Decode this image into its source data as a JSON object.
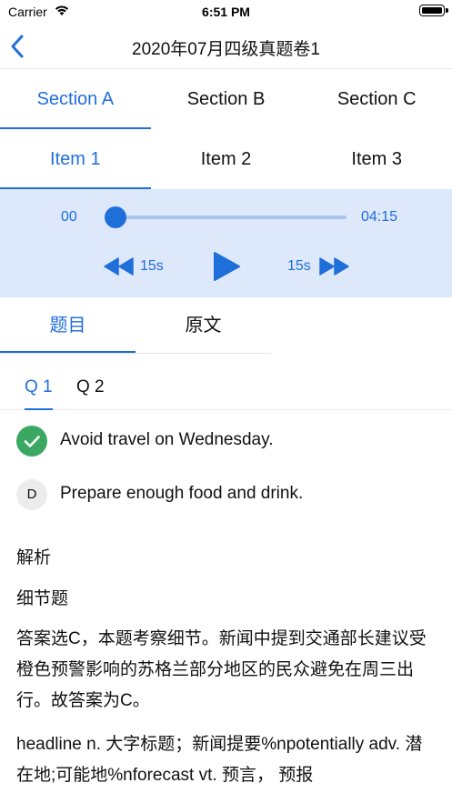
{
  "status": {
    "carrier": "Carrier",
    "time": "6:51 PM"
  },
  "nav": {
    "title": "2020年07月四级真题卷1"
  },
  "section_tabs": [
    {
      "label": "Section A",
      "active": true
    },
    {
      "label": "Section B",
      "active": false
    },
    {
      "label": "Section C",
      "active": false
    }
  ],
  "item_tabs": [
    {
      "label": "Item 1",
      "active": true
    },
    {
      "label": "Item 2",
      "active": false
    },
    {
      "label": "Item 3",
      "active": false
    }
  ],
  "player": {
    "current_time": "00",
    "total_time": "04:15",
    "progress": 0,
    "rewind_label": "15s",
    "forward_label": "15s",
    "accent_color": "#1f6fdb",
    "background_color": "#dde8fb"
  },
  "content_tabs": [
    {
      "label": "题目",
      "active": true
    },
    {
      "label": "原文",
      "active": false
    }
  ],
  "question_tabs": [
    {
      "label": "Q 1",
      "active": true
    },
    {
      "label": "Q 2",
      "active": false
    }
  ],
  "options": [
    {
      "marker": "check-icon",
      "text": "Avoid travel on Wednesday.",
      "state": "correct"
    },
    {
      "marker": "D",
      "text": "Prepare enough food and drink.",
      "state": "normal"
    }
  ],
  "analysis": {
    "title": "解析",
    "type": "细节题",
    "body": "答案选C，本题考察细节。新闻中提到交通部长建议受橙色预警影响的苏格兰部分地区的民众避免在周三出行。故答案为C。",
    "vocab": "headline n. 大字标题；新闻提要%npotentially adv. 潜在地;可能地%nforecast vt. 预言， 预报"
  }
}
